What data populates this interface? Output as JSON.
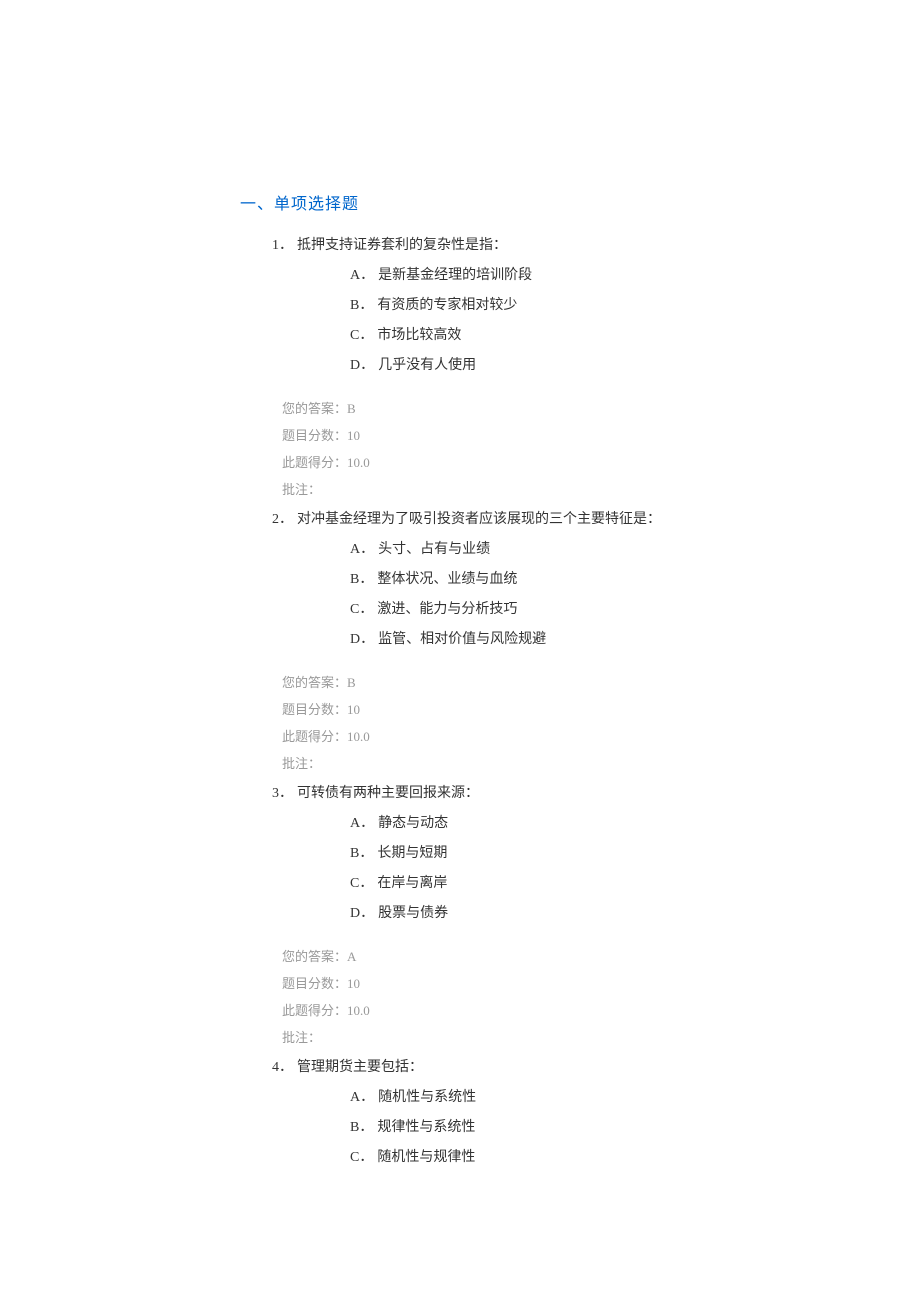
{
  "section_title": "一、单项选择题",
  "questions": [
    {
      "number": "1．",
      "text": "抵押支持证券套利的复杂性是指：",
      "options": [
        {
          "letter": "A．",
          "text": "是新基金经理的培训阶段"
        },
        {
          "letter": "B．",
          "text": "有资质的专家相对较少"
        },
        {
          "letter": "C．",
          "text": "市场比较高效"
        },
        {
          "letter": "D．",
          "text": "几乎没有人使用"
        }
      ],
      "feedback": {
        "answer_label": "您的答案：",
        "answer_value": "B",
        "score_label": "题目分数：",
        "score_value": "10",
        "earned_label": "此题得分：",
        "earned_value": "10.0",
        "note_label": "批注："
      }
    },
    {
      "number": "2．",
      "text": "对冲基金经理为了吸引投资者应该展现的三个主要特征是：",
      "options": [
        {
          "letter": "A．",
          "text": "头寸、占有与业绩"
        },
        {
          "letter": "B．",
          "text": "整体状况、业绩与血统"
        },
        {
          "letter": "C．",
          "text": "激进、能力与分析技巧"
        },
        {
          "letter": "D．",
          "text": "监管、相对价值与风险规避"
        }
      ],
      "feedback": {
        "answer_label": "您的答案：",
        "answer_value": "B",
        "score_label": "题目分数：",
        "score_value": "10",
        "earned_label": "此题得分：",
        "earned_value": "10.0",
        "note_label": "批注："
      }
    },
    {
      "number": "3．",
      "text": "可转债有两种主要回报来源：",
      "options": [
        {
          "letter": "A．",
          "text": "静态与动态"
        },
        {
          "letter": "B．",
          "text": "长期与短期"
        },
        {
          "letter": "C．",
          "text": "在岸与离岸"
        },
        {
          "letter": "D．",
          "text": "股票与债券"
        }
      ],
      "feedback": {
        "answer_label": "您的答案：",
        "answer_value": "A",
        "score_label": "题目分数：",
        "score_value": "10",
        "earned_label": "此题得分：",
        "earned_value": "10.0",
        "note_label": "批注："
      }
    },
    {
      "number": "4．",
      "text": "管理期货主要包括：",
      "options": [
        {
          "letter": "A．",
          "text": "随机性与系统性"
        },
        {
          "letter": "B．",
          "text": "规律性与系统性"
        },
        {
          "letter": "C．",
          "text": "随机性与规律性"
        }
      ],
      "feedback": null
    }
  ]
}
